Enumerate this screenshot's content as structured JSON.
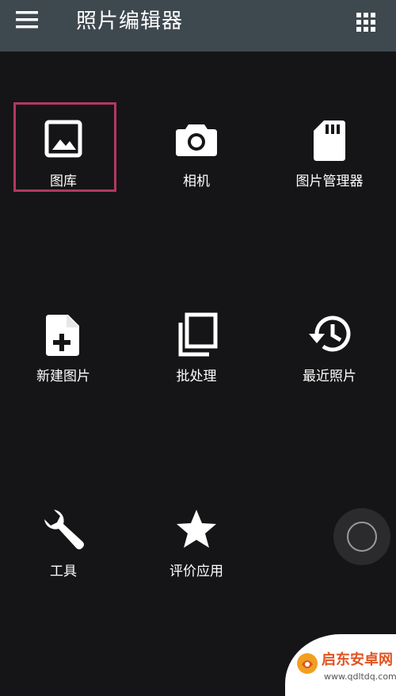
{
  "header": {
    "menu_icon": "hamburger-menu-icon",
    "title": "照片编辑器",
    "grid_icon": "apps-grid-icon"
  },
  "tiles": [
    {
      "label": "图库",
      "icon": "image-icon",
      "selected": true
    },
    {
      "label": "相机",
      "icon": "camera-icon"
    },
    {
      "label": "图片管理器",
      "icon": "sd-card-icon"
    },
    {
      "label": "新建图片",
      "icon": "new-file-icon"
    },
    {
      "label": "批处理",
      "icon": "batch-copy-icon"
    },
    {
      "label": "最近照片",
      "icon": "history-icon"
    },
    {
      "label": "工具",
      "icon": "wrench-icon"
    },
    {
      "label": "评价应用",
      "icon": "star-icon"
    }
  ],
  "colors": {
    "header_bg": "#3e484f",
    "background": "#151517",
    "selection": "#b3385f"
  },
  "watermark": {
    "name": "启东安卓网",
    "url": "www.qdltdq.com"
  }
}
